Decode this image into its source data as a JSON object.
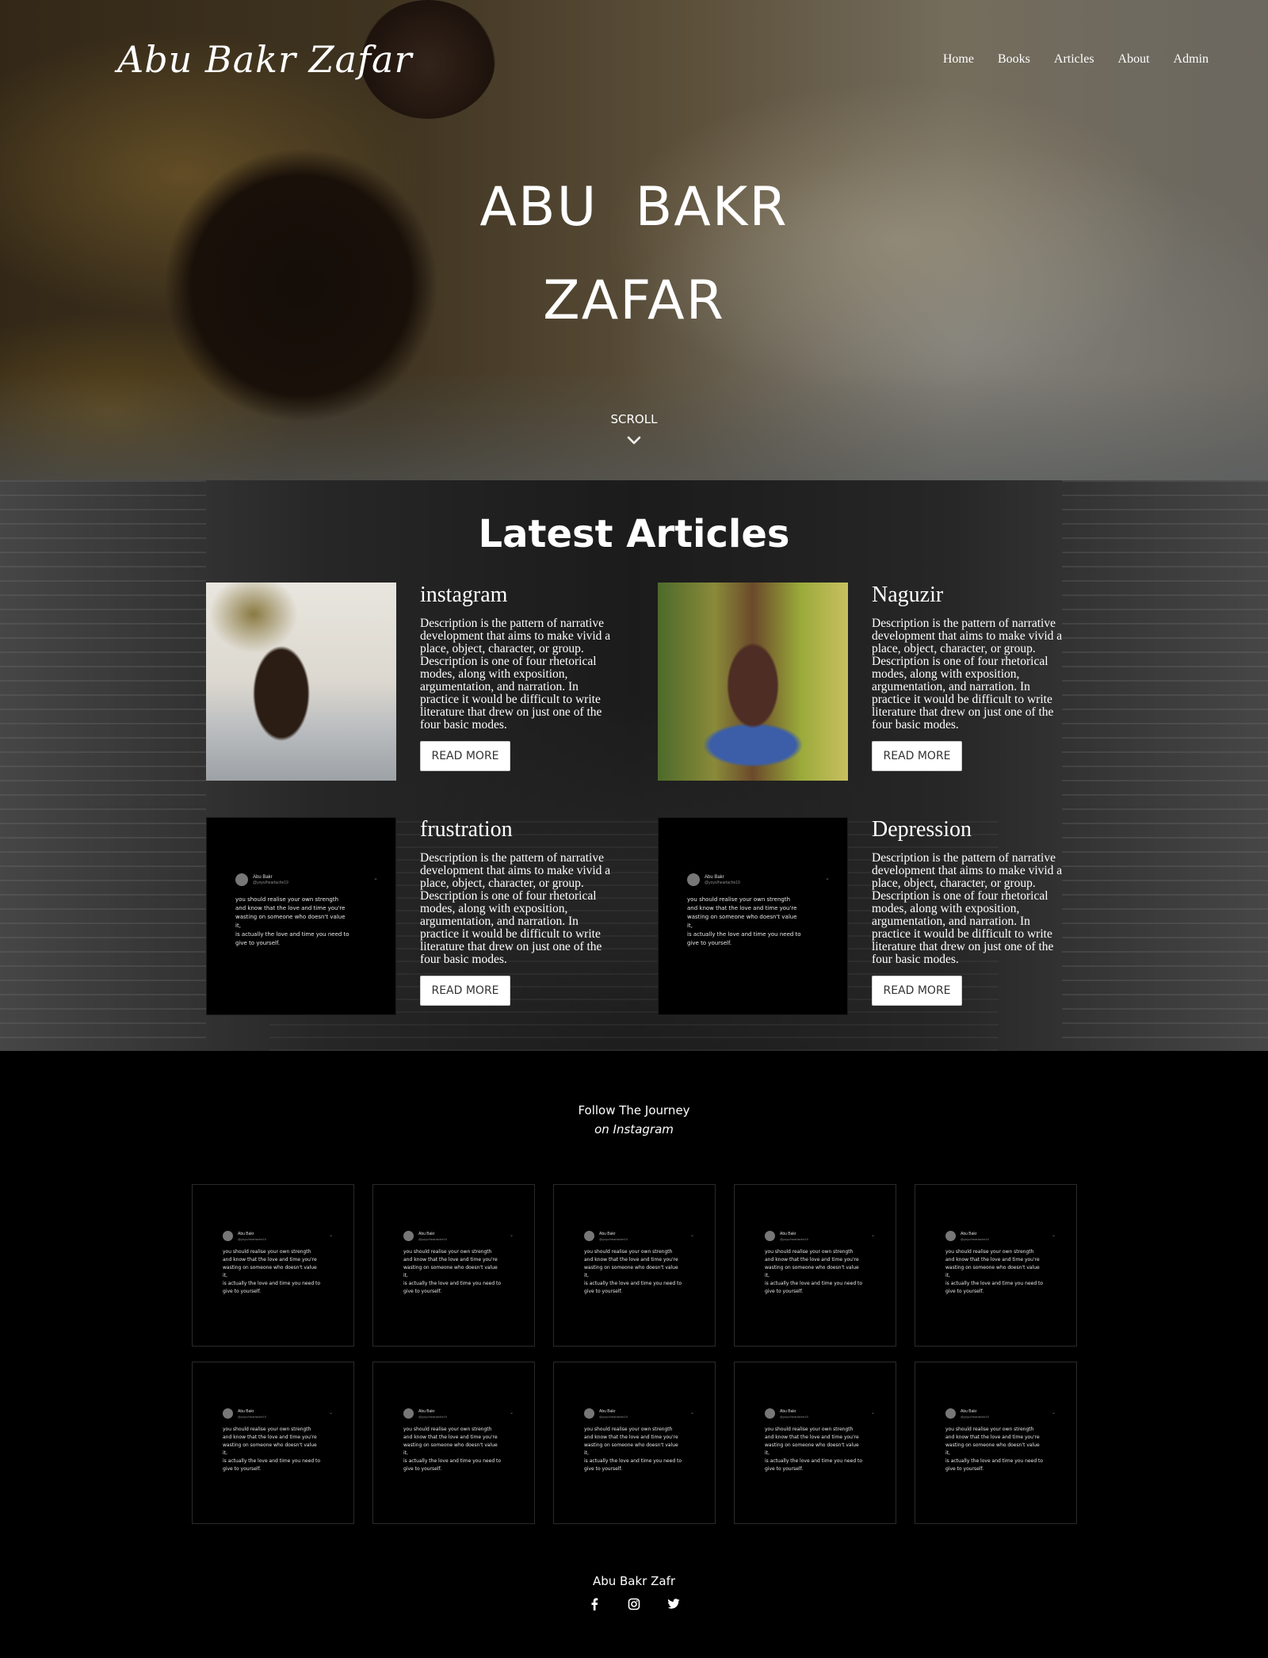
{
  "header": {
    "brand": "Abu Bakr Zafar",
    "nav": [
      "Home",
      "Books",
      "Articles",
      "About",
      "Admin"
    ]
  },
  "hero": {
    "title_line1": "ABU  BAKR",
    "title_line2": "ZAFAR",
    "scroll_label": "SCROLL"
  },
  "articles": {
    "section_title": "Latest Articles",
    "items": [
      {
        "title": "instagram",
        "description": "Description is the pattern of narrative development that aims to make vivid a place, object, character, or group. Description is one of four rhetorical modes, along with exposition, argumentation, and narration. In practice it would be difficult to write literature that drew on just one of the four basic modes.",
        "button": "READ MORE"
      },
      {
        "title": "Naguzir",
        "description": "Description is the pattern of narrative development that aims to make vivid a place, object, character, or group. Description is one of four rhetorical modes, along with exposition, argumentation, and narration. In practice it would be difficult to write literature that drew on just one of the four basic modes.",
        "button": "READ MORE"
      },
      {
        "title": "frustration",
        "description": "Description is the pattern of narrative development that aims to make vivid a place, object, character, or group. Description is one of four rhetorical modes, along with exposition, argumentation, and narration. In practice it would be difficult to write literature that drew on just one of the four basic modes.",
        "button": "READ MORE"
      },
      {
        "title": "Depression",
        "description": "Description is the pattern of narrative development that aims to make vivid a place, object, character, or group. Description is one of four rhetorical modes, along with exposition, argumentation, and narration. In practice it would be difficult to write literature that drew on just one of the four basic modes.",
        "button": "READ MORE"
      }
    ]
  },
  "tweet_image": {
    "name": "Abu Bakr",
    "handle": "@yoyo/heartache19",
    "lines": [
      "you should realise your own strength",
      "and know that the love and time you're",
      "wasting on someone who doesn't value",
      "it,",
      "is actually the love and time you need to",
      "give to yourself."
    ]
  },
  "instagram": {
    "heading": "Follow The Journey",
    "subheading": "on Instagram",
    "tile_count": 10
  },
  "footer": {
    "name": "Abu Bakr Zafr",
    "socials": [
      "facebook-icon",
      "instagram-icon",
      "twitter-icon"
    ]
  },
  "colors": {
    "background": "#000000",
    "text": "#ffffff",
    "button_bg": "#ffffff",
    "button_text": "#333333"
  }
}
